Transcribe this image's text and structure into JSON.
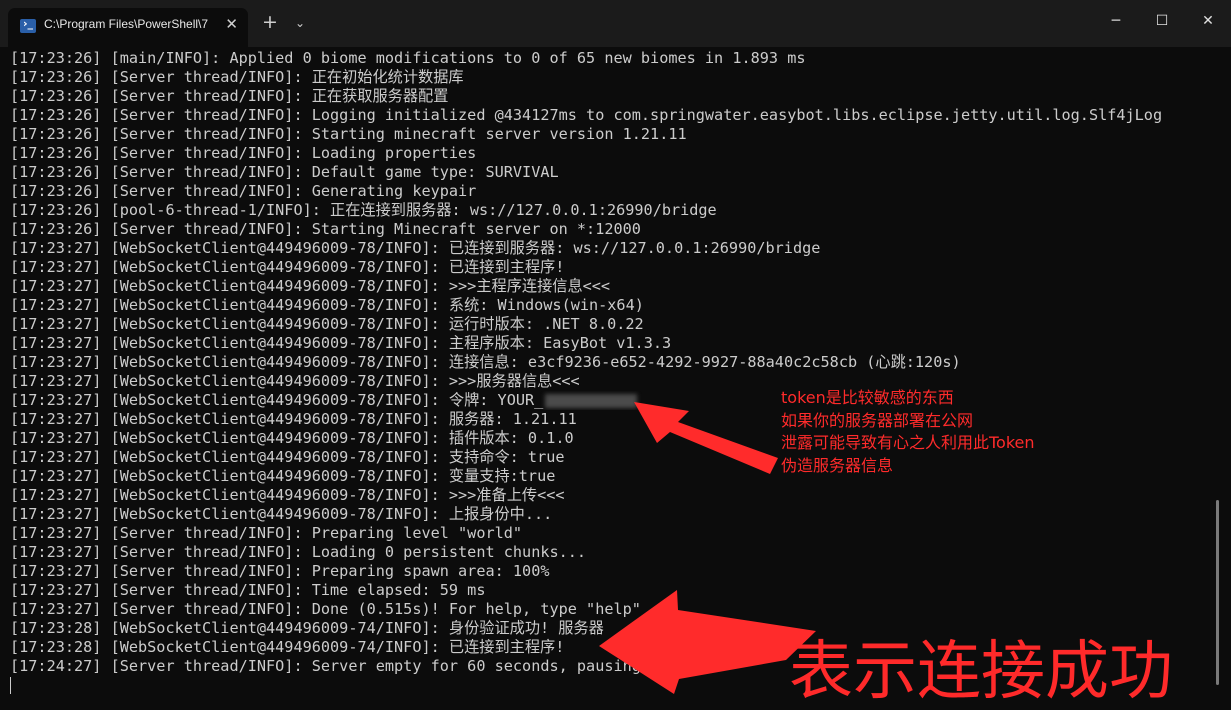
{
  "window": {
    "tab_title": "C:\\Program Files\\PowerShell\\7",
    "tab_icon": "powershell-icon",
    "close_tab_glyph": "✕",
    "new_tab_glyph": "+",
    "dropdown_glyph": "⌄",
    "minimize_glyph": "─",
    "maximize_glyph": "☐",
    "close_glyph": "✕"
  },
  "log_lines": [
    "[17:23:26] [main/INFO]: Applied 0 biome modifications to 0 of 65 new biomes in 1.893 ms",
    "[17:23:26] [Server thread/INFO]: 正在初始化统计数据库",
    "[17:23:26] [Server thread/INFO]: 正在获取服务器配置",
    "[17:23:26] [Server thread/INFO]: Logging initialized @434127ms to com.springwater.easybot.libs.eclipse.jetty.util.log.Slf4jLog",
    "[17:23:26] [Server thread/INFO]: Starting minecraft server version 1.21.11",
    "[17:23:26] [Server thread/INFO]: Loading properties",
    "[17:23:26] [Server thread/INFO]: Default game type: SURVIVAL",
    "[17:23:26] [Server thread/INFO]: Generating keypair",
    "[17:23:26] [pool-6-thread-1/INFO]: 正在连接到服务器: ws://127.0.0.1:26990/bridge",
    "[17:23:26] [Server thread/INFO]: Starting Minecraft server on *:12000",
    "[17:23:27] [WebSocketClient@449496009-78/INFO]: 已连接到服务器: ws://127.0.0.1:26990/bridge",
    "[17:23:27] [WebSocketClient@449496009-78/INFO]: 已连接到主程序!",
    "[17:23:27] [WebSocketClient@449496009-78/INFO]: >>>主程序连接信息<<<",
    "[17:23:27] [WebSocketClient@449496009-78/INFO]: 系统: Windows(win-x64)",
    "[17:23:27] [WebSocketClient@449496009-78/INFO]: 运行时版本: .NET 8.0.22",
    "[17:23:27] [WebSocketClient@449496009-78/INFO]: 主程序版本: EasyBot v1.3.3",
    "[17:23:27] [WebSocketClient@449496009-78/INFO]: 连接信息: e3cf9236-e652-4292-9927-88a40c2c58cb (心跳:120s)",
    "[17:23:27] [WebSocketClient@449496009-78/INFO]: >>>服务器信息<<<",
    "[17:23:27] [WebSocketClient@449496009-78/INFO]: 令牌: YOUR_",
    "[17:23:27] [WebSocketClient@449496009-78/INFO]: 服务器: 1.21.11",
    "[17:23:27] [WebSocketClient@449496009-78/INFO]: 插件版本: 0.1.0",
    "[17:23:27] [WebSocketClient@449496009-78/INFO]: 支持命令: true",
    "[17:23:27] [WebSocketClient@449496009-78/INFO]: 变量支持:true",
    "[17:23:27] [WebSocketClient@449496009-78/INFO]: >>>准备上传<<<",
    "[17:23:27] [WebSocketClient@449496009-78/INFO]: 上报身份中...",
    "[17:23:27] [Server thread/INFO]: Preparing level \"world\"",
    "[17:23:27] [Server thread/INFO]: Loading 0 persistent chunks...",
    "[17:23:27] [Server thread/INFO]: Preparing spawn area: 100%",
    "[17:23:27] [Server thread/INFO]: Time elapsed: 59 ms",
    "[17:23:27] [Server thread/INFO]: Done (0.515s)! For help, type \"help\"",
    "[17:23:28] [WebSocketClient@449496009-74/INFO]: 身份验证成功! 服务器",
    "[17:23:28] [WebSocketClient@449496009-74/INFO]: 已连接到主程序!",
    "[17:24:27] [Server thread/INFO]: Server empty for 60 seconds, pausing"
  ],
  "annotations": {
    "token_note": [
      "token是比较敏感的东西",
      "如果你的服务器部署在公网",
      "泄露可能导致有心之人利用此Token",
      "伪造服务器信息"
    ],
    "success_note": "表示连接成功",
    "annotation_color": "#ff2b2b"
  },
  "colors": {
    "background": "#0c0c0c",
    "text": "#cccccc",
    "titlebar": "#1b1b1b"
  }
}
